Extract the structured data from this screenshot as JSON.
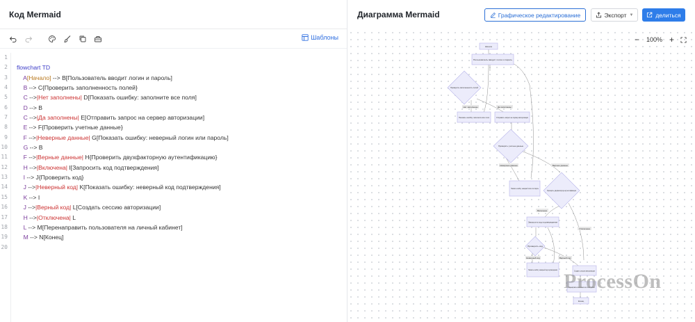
{
  "left_panel": {
    "title": "Код Mermaid",
    "toolbar": {
      "undo_icon": "undo-icon",
      "redo_icon": "redo-icon",
      "palette_icon": "palette-icon",
      "brush_icon": "brush-icon",
      "copy_icon": "copy-icon",
      "clear_icon": "clear-icon",
      "templates_label": "Шаблоны"
    },
    "line_numbers": [
      "1",
      "2",
      "3",
      "4",
      "5",
      "6",
      "7",
      "8",
      "9",
      "10",
      "11",
      "12",
      "13",
      "14",
      "15",
      "16",
      "17",
      "18",
      "19",
      "20"
    ],
    "code_lines": [
      [],
      [
        {
          "t": "flowchart TD",
          "c": "kw"
        }
      ],
      [
        {
          "t": "    "
        },
        {
          "t": "A",
          "c": "nd"
        },
        {
          "t": "[Начало]",
          "c": "lb-or"
        },
        {
          "t": " --> B[Пользователь вводит логин и пароль]"
        }
      ],
      [
        {
          "t": "    "
        },
        {
          "t": "B",
          "c": "nd"
        },
        {
          "t": " --> C{Проверить заполненность полей}"
        }
      ],
      [
        {
          "t": "    "
        },
        {
          "t": "C",
          "c": "nd"
        },
        {
          "t": " -->"
        },
        {
          "t": "|Нет заполнены|",
          "c": "lb"
        },
        {
          "t": " D[Показать ошибку: заполните все поля]"
        }
      ],
      [
        {
          "t": "    "
        },
        {
          "t": "D",
          "c": "nd"
        },
        {
          "t": " --> B"
        }
      ],
      [
        {
          "t": "    "
        },
        {
          "t": "C",
          "c": "nd"
        },
        {
          "t": " -->"
        },
        {
          "t": "|Да заполнены|",
          "c": "lb"
        },
        {
          "t": " E[Отправить запрос на сервер авторизации]"
        }
      ],
      [
        {
          "t": "    "
        },
        {
          "t": "E",
          "c": "nd"
        },
        {
          "t": " --> F{Проверить учетные данные}"
        }
      ],
      [
        {
          "t": "    "
        },
        {
          "t": "F",
          "c": "nd"
        },
        {
          "t": " -->"
        },
        {
          "t": "|Неверные данные|",
          "c": "lb"
        },
        {
          "t": " G[Показать ошибку: неверный логин или пароль]"
        }
      ],
      [
        {
          "t": "    "
        },
        {
          "t": "G",
          "c": "nd"
        },
        {
          "t": " --> B"
        }
      ],
      [
        {
          "t": "    "
        },
        {
          "t": "F",
          "c": "nd"
        },
        {
          "t": " -->"
        },
        {
          "t": "|Верные данные|",
          "c": "lb"
        },
        {
          "t": " H{Проверить двухфакторную аутентификацию}"
        }
      ],
      [
        {
          "t": "    "
        },
        {
          "t": "H",
          "c": "nd"
        },
        {
          "t": " -->"
        },
        {
          "t": "|Включена|",
          "c": "lb"
        },
        {
          "t": " I[Запросить код подтверждения]"
        }
      ],
      [
        {
          "t": "    "
        },
        {
          "t": "I",
          "c": "nd"
        },
        {
          "t": " --> J{Проверить код}"
        }
      ],
      [
        {
          "t": "    "
        },
        {
          "t": "J",
          "c": "nd"
        },
        {
          "t": " -->"
        },
        {
          "t": "|Неверный код|",
          "c": "lb"
        },
        {
          "t": " K[Показать ошибку: неверный код подтверждения]"
        }
      ],
      [
        {
          "t": "    "
        },
        {
          "t": "K",
          "c": "nd"
        },
        {
          "t": " --> I"
        }
      ],
      [
        {
          "t": "    "
        },
        {
          "t": "J",
          "c": "nd"
        },
        {
          "t": " -->"
        },
        {
          "t": "|Верный код|",
          "c": "lb"
        },
        {
          "t": " L[Создать сессию авторизации]"
        }
      ],
      [
        {
          "t": "    "
        },
        {
          "t": "H",
          "c": "nd"
        },
        {
          "t": " -->"
        },
        {
          "t": "|Отключена|",
          "c": "lb"
        },
        {
          "t": " L"
        }
      ],
      [
        {
          "t": "    "
        },
        {
          "t": "L",
          "c": "nd"
        },
        {
          "t": " --> M[Перенаправить пользователя на личный кабинет]"
        }
      ],
      [
        {
          "t": "    "
        },
        {
          "t": "M",
          "c": "nd"
        },
        {
          "t": " --> N[Конец]"
        }
      ],
      []
    ]
  },
  "right_panel": {
    "title": "Диаграмма Mermaid",
    "graph_edit_label": "Графическое редактирование",
    "graph_edit_icon": "edit-icon",
    "export_label": "Экспорт",
    "export_icon": "export-icon",
    "share_label": "делиться",
    "share_icon": "share-icon",
    "zoom_level": "100%",
    "zoom_out": "−",
    "zoom_in": "+",
    "fullscreen_icon": "fullscreen-icon",
    "watermark": "ProcessOn"
  },
  "diagram": {
    "nodes": {
      "A": "Начало",
      "B": "Пользователь вводит логин и пароль",
      "C": "Проверить заполненность полей",
      "D": "Показать ошибку: заполните все поля",
      "E": "Отправить запрос на сервер авторизации",
      "F": "Проверить учетные данные",
      "G": "Показать ошибку: неверный логин или пароль",
      "H": "Проверить двухфакторную аутентификацию",
      "I": "Запросить код подтверждения",
      "J": "Проверить код",
      "K": "Показать ошибку: неверный код подтверждения",
      "L": "Создать сессию авторизации",
      "M": "Перенаправить пользователя на личный кабинет",
      "N": "Конец"
    },
    "edge_labels": {
      "c_d": "Нет заполнены",
      "c_e": "Да заполнены",
      "f_g": "Неверные данные",
      "f_h": "Верные данные",
      "h_i": "Включена",
      "j_k": "Неверный код",
      "j_l": "Верный код",
      "h_l": "Отключена"
    }
  },
  "colors": {
    "accent": "#2e7de9",
    "node_fill": "#ececfb",
    "node_stroke": "#b7b4ea"
  }
}
